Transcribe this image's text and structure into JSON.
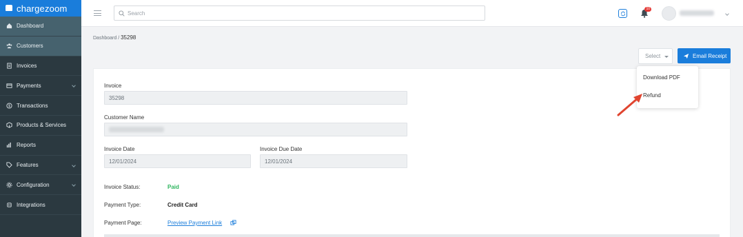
{
  "brand": {
    "name": "chargezoom"
  },
  "sidebar": {
    "items": [
      {
        "label": "Dashboard",
        "icon": "home-icon",
        "active": true,
        "has_submenu": false
      },
      {
        "label": "Customers",
        "icon": "users-icon",
        "active": true,
        "has_submenu": false
      },
      {
        "label": "Invoices",
        "icon": "invoice-icon",
        "active": false,
        "has_submenu": false
      },
      {
        "label": "Payments",
        "icon": "card-icon",
        "active": false,
        "has_submenu": true
      },
      {
        "label": "Transactions",
        "icon": "dollar-icon",
        "active": false,
        "has_submenu": false
      },
      {
        "label": "Products & Services",
        "icon": "box-icon",
        "active": false,
        "has_submenu": false
      },
      {
        "label": "Reports",
        "icon": "chart-icon",
        "active": false,
        "has_submenu": false
      },
      {
        "label": "Features",
        "icon": "tag-icon",
        "active": false,
        "has_submenu": true
      },
      {
        "label": "Configuration",
        "icon": "gear-icon",
        "active": false,
        "has_submenu": true
      },
      {
        "label": "Integrations",
        "icon": "plug-icon",
        "active": false,
        "has_submenu": false
      }
    ]
  },
  "topbar": {
    "search_placeholder": "Search",
    "notification_count": "10",
    "accent_color": "#1a7ddb"
  },
  "breadcrumb": {
    "parent": "Dashboard",
    "separator": " / ",
    "current": "35298"
  },
  "actions": {
    "select_label": "Select",
    "email_label": "Email Receipt"
  },
  "dropdown": {
    "items": [
      "Download PDF",
      "Refund"
    ]
  },
  "invoice": {
    "invoice_label": "Invoice",
    "invoice_value": "35298",
    "customer_label": "Customer Name",
    "invoice_date_label": "Invoice Date",
    "invoice_date_value": "12/01/2024",
    "due_date_label": "Invoice Due Date",
    "due_date_value": "12/01/2024",
    "status_label": "Invoice Status:",
    "status_value": "Paid",
    "payment_type_label": "Payment Type:",
    "payment_type_value": "Credit Card",
    "payment_page_label": "Payment Page:",
    "payment_page_link": "Preview Payment Link"
  }
}
